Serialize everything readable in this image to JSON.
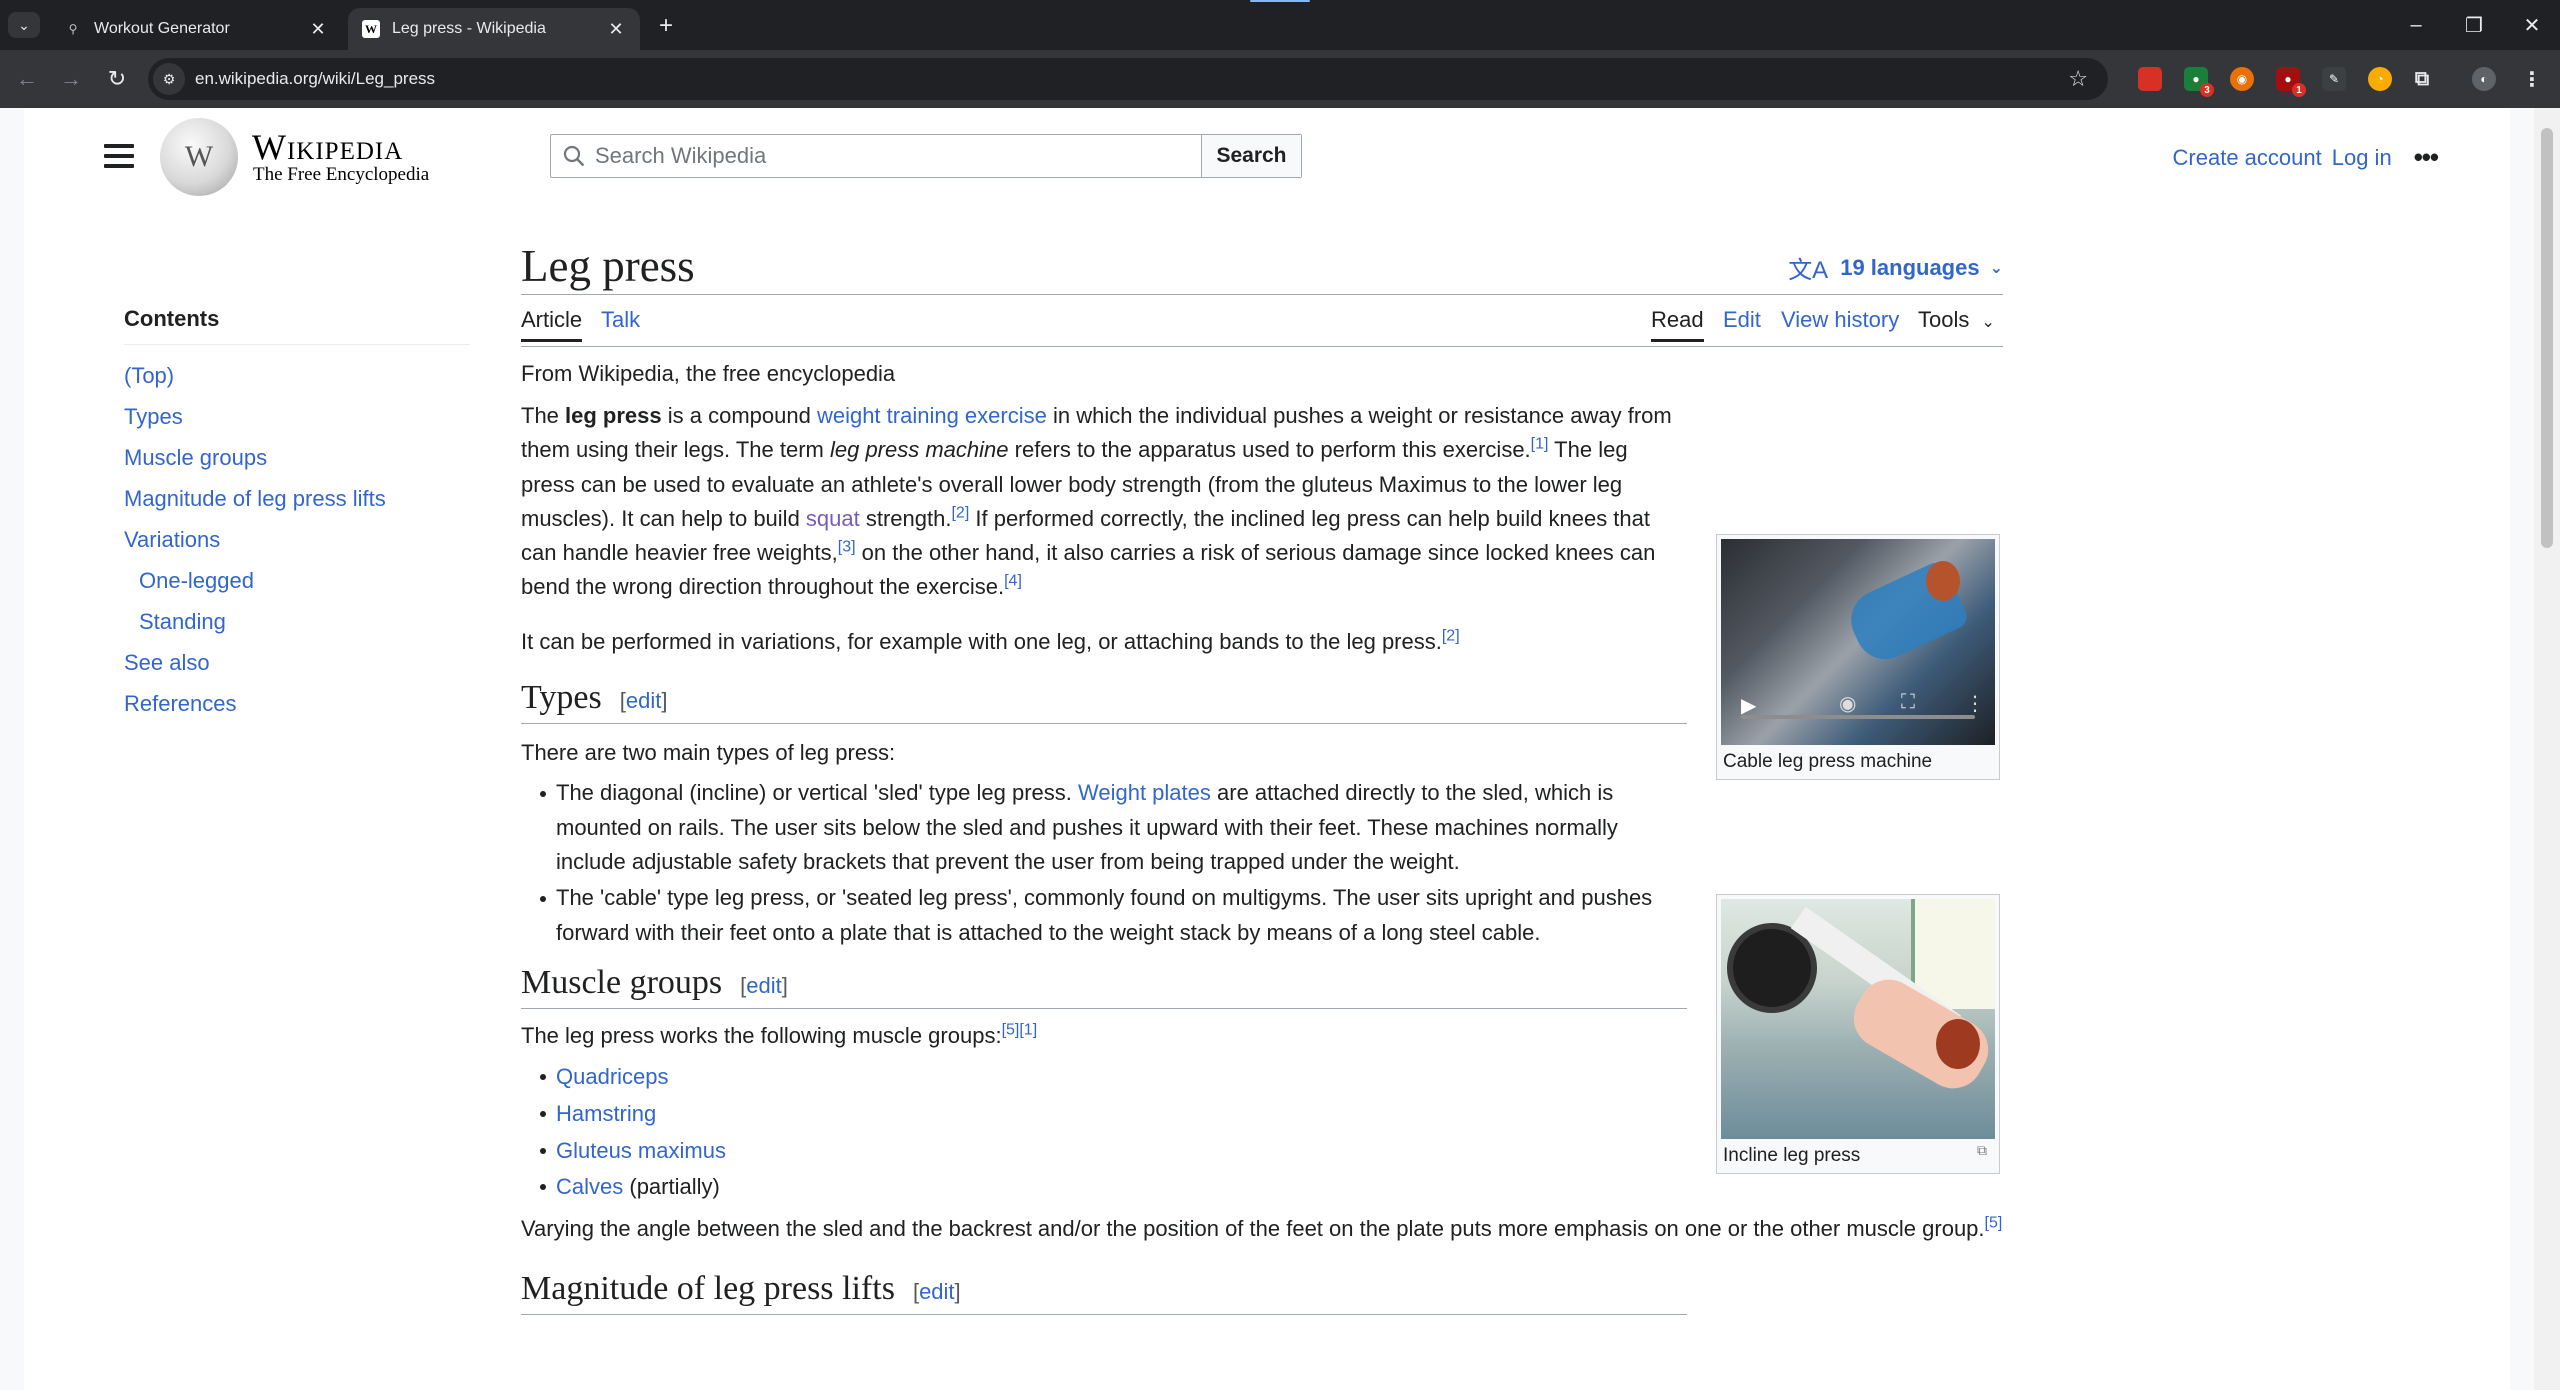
{
  "browser": {
    "tabs": [
      {
        "title": "Workout Generator",
        "favicon": "WG"
      },
      {
        "title": "Leg press - Wikipedia",
        "favicon": "W"
      }
    ],
    "url": "en.wikipedia.org/wiki/Leg_press",
    "extension_badges": [
      "3",
      "1"
    ]
  },
  "header": {
    "logo_word": "Wikipedia",
    "logo_tagline": "The Free Encyclopedia",
    "search_placeholder": "Search Wikipedia",
    "search_button": "Search",
    "create_account": "Create account",
    "log_in": "Log in"
  },
  "toc": {
    "title": "Contents",
    "items": [
      {
        "label": "(Top)",
        "level": 1
      },
      {
        "label": "Types",
        "level": 1
      },
      {
        "label": "Muscle groups",
        "level": 1
      },
      {
        "label": "Magnitude of leg press lifts",
        "level": 1
      },
      {
        "label": "Variations",
        "level": 1
      },
      {
        "label": "One-legged",
        "level": 2
      },
      {
        "label": "Standing",
        "level": 2
      },
      {
        "label": "See also",
        "level": 1
      },
      {
        "label": "References",
        "level": 1
      }
    ]
  },
  "article": {
    "title": "Leg press",
    "languages": "19 languages",
    "tabs": {
      "article": "Article",
      "talk": "Talk",
      "read": "Read",
      "edit": "Edit",
      "history": "View history",
      "tools": "Tools"
    },
    "from": "From Wikipedia, the free encyclopedia",
    "intro": {
      "t1": "The ",
      "b1": "leg press",
      "t2": " is a compound ",
      "l1": "weight training exercise",
      "t3": " in which the individual pushes a weight or resistance away from them using their legs. The term ",
      "i1": "leg press machine",
      "t4": " refers to the apparatus used to perform this exercise.",
      "r1": "[1]",
      "t5": " The leg press can be used to evaluate an athlete's overall lower body strength (from the gluteus Maximus to the lower leg muscles). It can help to build ",
      "l2": "squat",
      "t6": " strength.",
      "r2": "[2]",
      "t7": " If performed correctly, the inclined leg press can help build knees that can handle heavier free weights,",
      "r3": "[3]",
      "t8": " on the other hand, it also carries a risk of serious damage since locked knees can bend the wrong direction throughout the exercise.",
      "r4": "[4]"
    },
    "para2": {
      "text": "It can be performed in variations, for example with one leg, or attaching bands to the leg press.",
      "ref": "[2]"
    },
    "edit_label": "edit",
    "types": {
      "heading": "Types",
      "intro": "There are two main types of leg press:",
      "b1_pre": "The diagonal (incline) or vertical 'sled' type leg press. ",
      "b1_link": "Weight plates",
      "b1_post": " are attached directly to the sled, which is mounted on rails. The user sits below the sled and pushes it upward with their feet. These machines normally include adjustable safety brackets that prevent the user from being trapped under the weight.",
      "b2": "The 'cable' type leg press, or 'seated leg press', commonly found on multigyms. The user sits upright and pushes forward with their feet onto a plate that is attached to the weight stack by means of a long steel cable."
    },
    "muscles": {
      "heading": "Muscle groups",
      "intro": "The leg press works the following muscle groups:",
      "refs": "[5][1]",
      "items": [
        "Quadriceps",
        "Hamstring",
        "Gluteus maximus",
        "Calves"
      ],
      "calves_note": " (partially)",
      "outro": "Varying the angle between the sled and the backrest and/or the position of the feet on the plate puts more emphasis on one or the other muscle group.",
      "outro_ref": "[5]"
    },
    "magnitude": {
      "heading": "Magnitude of leg press lifts"
    },
    "figures": {
      "video_caption": "Cable leg press machine",
      "photo_caption": "Incline leg press"
    }
  }
}
